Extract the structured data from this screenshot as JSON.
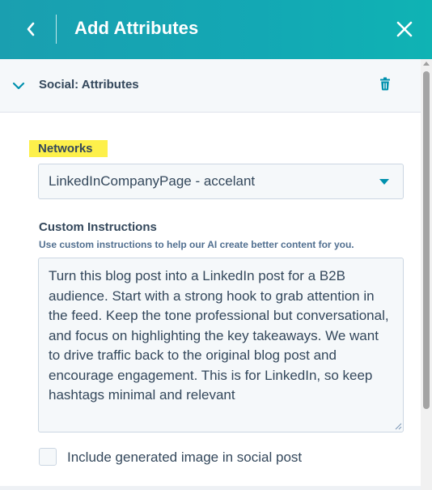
{
  "header": {
    "title": "Add Attributes",
    "back_icon": "chevron-left-icon",
    "close_icon": "close-icon"
  },
  "section": {
    "title": "Social: Attributes",
    "expand_icon": "chevron-down-icon",
    "delete_icon": "trash-icon"
  },
  "networks": {
    "label": "Networks",
    "selected_value": "LinkedInCompanyPage - accelant"
  },
  "custom_instructions": {
    "label": "Custom Instructions",
    "help_text": "Use custom instructions to help our AI create better content for you.",
    "value": "Turn this blog post into a LinkedIn post for a B2B audience. Start with a strong hook to grab attention in the feed. Keep the tone professional but conversational, and focus on highlighting the key takeaways. We want to drive traffic back to the original blog post and encourage engagement. This is for LinkedIn, so keep hashtags minimal and relevant"
  },
  "include_image": {
    "label": "Include generated image in social post",
    "checked": false
  },
  "colors": {
    "header_gradient_start": "#1a9fb0",
    "header_gradient_end": "#0fb3b4",
    "accent": "#0091ae",
    "text": "#33475b",
    "highlight": "#fdf04b"
  }
}
